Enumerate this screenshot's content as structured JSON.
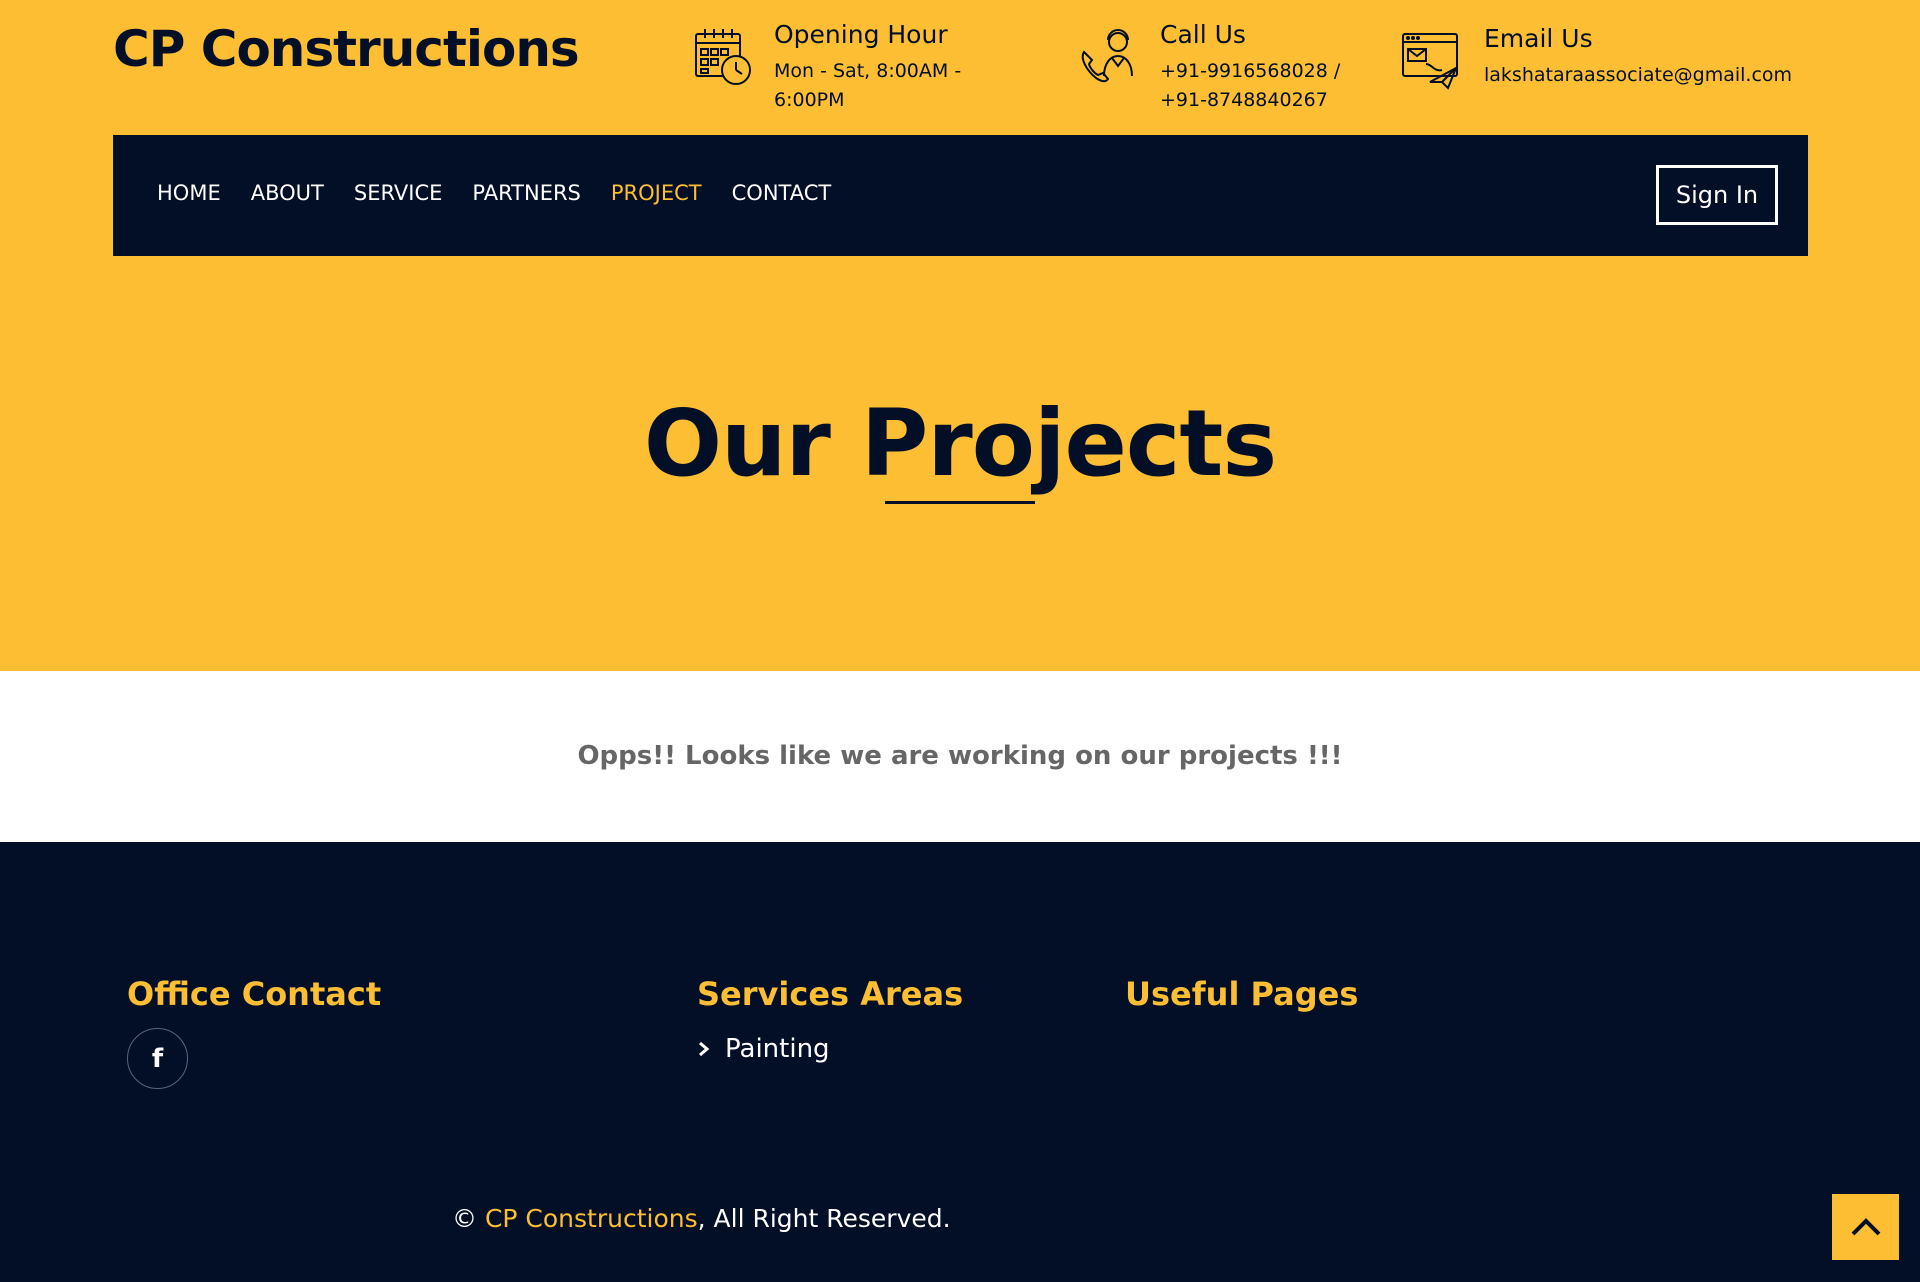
{
  "header": {
    "brand": "CP Constructions",
    "opening": {
      "title": "Opening Hour",
      "value": "Mon - Sat, 8:00AM - 6:00PM",
      "icon": "calendar-clock-icon"
    },
    "call": {
      "title": "Call Us",
      "value": "+91-9916568028 / +91-8748840267",
      "icon": "support-agent-phone-icon"
    },
    "email": {
      "title": "Email Us",
      "value": "lakshataraassociate@gmail.com",
      "icon": "email-send-icon"
    }
  },
  "nav": {
    "items": [
      {
        "label": "HOME",
        "active": false
      },
      {
        "label": "ABOUT",
        "active": false
      },
      {
        "label": "SERVICE",
        "active": false
      },
      {
        "label": "PARTNERS",
        "active": false
      },
      {
        "label": "PROJECT",
        "active": true
      },
      {
        "label": "CONTACT",
        "active": false
      }
    ],
    "sign_in": "Sign In"
  },
  "hero": {
    "title": "Our Projects"
  },
  "main": {
    "message": "Opps!! Looks like we are working on our projects !!!"
  },
  "footer": {
    "office_heading": "Office Contact",
    "services_heading": "Services Areas",
    "useful_heading": "Useful Pages",
    "social": [
      {
        "icon": "facebook-icon",
        "glyph": "f"
      }
    ],
    "services": [
      "Painting"
    ],
    "copyright_symbol": "©",
    "copyright_brand": "CP Constructions",
    "copyright_suffix": ", All Right Reserved."
  },
  "colors": {
    "primary": "#FDBE33",
    "dark": "#030F27",
    "white": "#FFFFFF",
    "muted": "#666666"
  }
}
